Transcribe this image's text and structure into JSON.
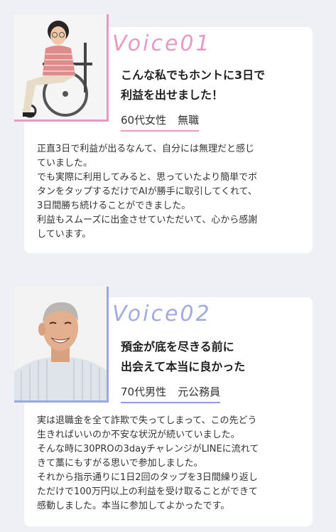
{
  "testimonials": [
    {
      "voice": "Voice01",
      "headline": [
        "こんな私でもホントに3日で",
        "利益を出せました！"
      ],
      "person": {
        "age": "60代女性",
        "job": "無職"
      },
      "body": [
        "正直3日で利益が出るなんて、自分には無理だと感じ",
        "ていました。",
        "でも実際に利用してみると、思っていたより簡単でボ",
        "タンをタップするだけでAIが勝手に取引してくれて、",
        "3日間勝ち続けることができました。",
        "利益もスムーズに出金させていただいて、心から感謝",
        "しています。"
      ],
      "accent": "#e89ac4"
    },
    {
      "voice": "Voice02",
      "headline": [
        "預金が底を尽きる前に",
        "出会えて本当に良かった"
      ],
      "person": {
        "age": "70代男性",
        "job": "元公務員"
      },
      "body": [
        "実は退職金を全て詐欺で失ってしまって、この先どう",
        "生きればいいのか不安な状況が続いていました。",
        "そんな時に30PROの3dayチャレンジがLINEに流れて",
        "きて藁にもすがる思いで参加しました。",
        "それから指示通りに1日2回のタップを3日間繰り返し",
        "ただけで100万円以上の利益を受け取ることができて",
        "感動しました。本当に参加してよかったです。"
      ],
      "accent": "#a2acdf"
    }
  ]
}
